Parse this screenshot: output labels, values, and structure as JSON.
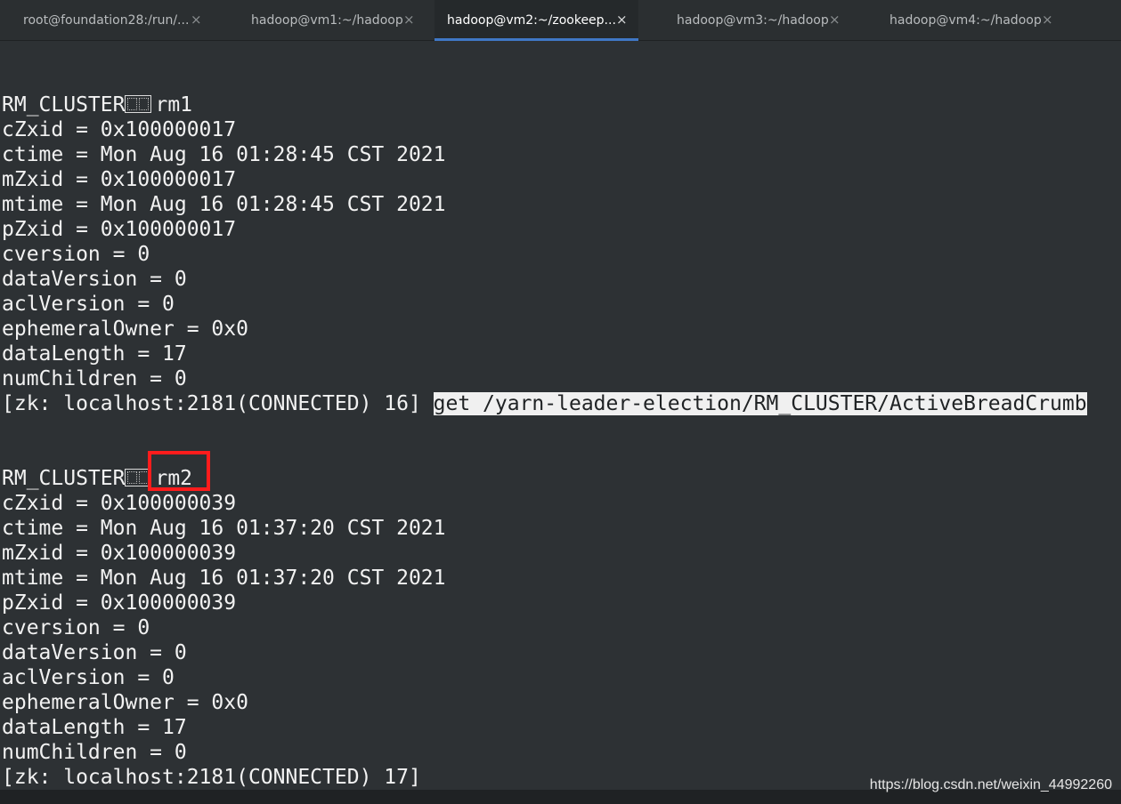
{
  "tabs": [
    {
      "label": "root@foundation28:/run/...",
      "close": "×"
    },
    {
      "label": "hadoop@vm1:~/hadoop",
      "close": "×"
    },
    {
      "label": "hadoop@vm2:~/zookeep...",
      "close": "×",
      "active": true
    },
    {
      "label": "hadoop@vm3:~/hadoop",
      "close": "×"
    },
    {
      "label": "hadoop@vm4:~/hadoop",
      "close": "×"
    }
  ],
  "terminal": {
    "block1": {
      "header_prefix": "RM_CLUSTER",
      "header_suffix": "rm1",
      "stats": [
        "cZxid = 0x100000017",
        "ctime = Mon Aug 16 01:28:45 CST 2021",
        "mZxid = 0x100000017",
        "mtime = Mon Aug 16 01:28:45 CST 2021",
        "pZxid = 0x100000017",
        "cversion = 0",
        "dataVersion = 0",
        "aclVersion = 0",
        "ephemeralOwner = 0x0",
        "dataLength = 17",
        "numChildren = 0"
      ],
      "prompt": "[zk: localhost:2181(CONNECTED) 16] ",
      "command": "get /yarn-leader-election/RM_CLUSTER/ActiveBreadCrumb"
    },
    "block2": {
      "header_prefix": "RM_CLUSTER",
      "header_suffix": "rm2",
      "stats": [
        "cZxid = 0x100000039",
        "ctime = Mon Aug 16 01:37:20 CST 2021",
        "mZxid = 0x100000039",
        "mtime = Mon Aug 16 01:37:20 CST 2021",
        "pZxid = 0x100000039",
        "cversion = 0",
        "dataVersion = 0",
        "aclVersion = 0",
        "ephemeralOwner = 0x0",
        "dataLength = 17",
        "numChildren = 0"
      ],
      "prompt": "[zk: localhost:2181(CONNECTED) 17]"
    }
  },
  "watermark": "https://blog.csdn.net/weixin_44992260",
  "colors": {
    "background": "#2d3134",
    "text": "#f2f2f2",
    "active_tab_underline": "#3f77c6",
    "highlight_box": "#ff1c1c"
  }
}
